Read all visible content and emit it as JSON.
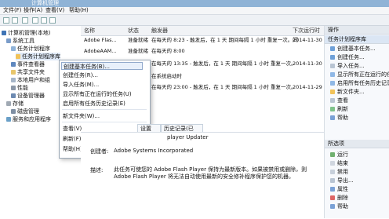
{
  "window": {
    "title": "计算机管理"
  },
  "menu": [
    "文件(F)",
    "操作(A)",
    "查看(V)",
    "帮助(H)"
  ],
  "toolbar": [
    "back-button",
    "forward-button",
    "up-button",
    "show-hide-tree-button",
    "help-button",
    "view-button"
  ],
  "sidebar": {
    "items": [
      {
        "label": "计算机管理(本地)",
        "level": 0
      },
      {
        "label": "系统工具",
        "level": 1
      },
      {
        "label": "任务计划程序",
        "level": 2
      },
      {
        "label": "任务计划程序库",
        "level": 3
      },
      {
        "label": "事件查看器",
        "level": 2
      },
      {
        "label": "共享文件夹",
        "level": 2
      },
      {
        "label": "本地用户和组",
        "level": 2
      },
      {
        "label": "性能",
        "level": 2
      },
      {
        "label": "设备管理器",
        "level": 2
      },
      {
        "label": "存储",
        "level": 1
      },
      {
        "label": "磁盘管理",
        "level": 2
      },
      {
        "label": "服务和应用程序",
        "level": 1
      }
    ]
  },
  "table": {
    "columns": [
      "名称",
      "状态",
      "触发器",
      "下次运行时间"
    ],
    "rows": [
      {
        "name": "Adobe Flas...",
        "status": "准备就绪",
        "trigger": "在每天的 8:23 - 触发后，在 1 天 期间每隔 1 小时 重复一次。",
        "next": "2014-11-30"
      },
      {
        "name": "AdobeAAM...",
        "status": "准备就绪",
        "trigger": "在每天的 8:00",
        "next": ""
      },
      {
        "name": "",
        "status": "",
        "trigger": "在每天的 13:35 - 触发后，在 1 天 期间每隔 1 小时 重复一次。",
        "next": "2014-11-30"
      },
      {
        "name": "",
        "status": "",
        "trigger": "在系统启动时",
        "next": ""
      },
      {
        "name": "",
        "status": "",
        "trigger": "在每天的 23:00 - 触发后，在 1 天 期间每隔 1 小时 重复一次。",
        "next": "2014-11-29"
      },
      {
        "name": "",
        "status": "",
        "trigger": "",
        "next": ""
      }
    ]
  },
  "context_menu": {
    "items": [
      {
        "label": "创建基本任务(B)...",
        "highlight": true
      },
      {
        "label": "创建任务(R)..."
      },
      {
        "label": "导入任务(M)..."
      },
      {
        "label": "显示所有正在运行的任务(U)"
      },
      {
        "label": "启用所有任务历史记录(E)"
      },
      {
        "label": "新文件夹(W)..."
      },
      {
        "label": "查看(V)",
        "arrow": true
      },
      {
        "label": "刷新(F)"
      },
      {
        "label": "帮助(H)"
      }
    ]
  },
  "tabs": [
    "设置",
    "历史记录(已"
  ],
  "details": {
    "name_value": "player Updater",
    "creator_label": "创建者:",
    "creator_value": "Adobe Systems Incorporated",
    "desc_label": "描述:",
    "desc_text": "此任务可使您的 Adobe Flash Player 保持为最新版本。如果被禁用或删除，则 Adobe Flash Player 将无法自动使用最新的安全修补程序保护您的机器。"
  },
  "right_panel": {
    "header1": "操作",
    "section": "任务计划程序库",
    "items": [
      "创建基本任务...",
      "创建任务...",
      "导入任务...",
      "显示所有正在运行的任务",
      "启用所有任务历史记录",
      "新文件夹...",
      "查看",
      "刷新",
      "帮助"
    ],
    "header2": "所选项",
    "items2": [
      "运行",
      "结束",
      "禁用",
      "导出...",
      "属性",
      "删除",
      "帮助"
    ]
  }
}
